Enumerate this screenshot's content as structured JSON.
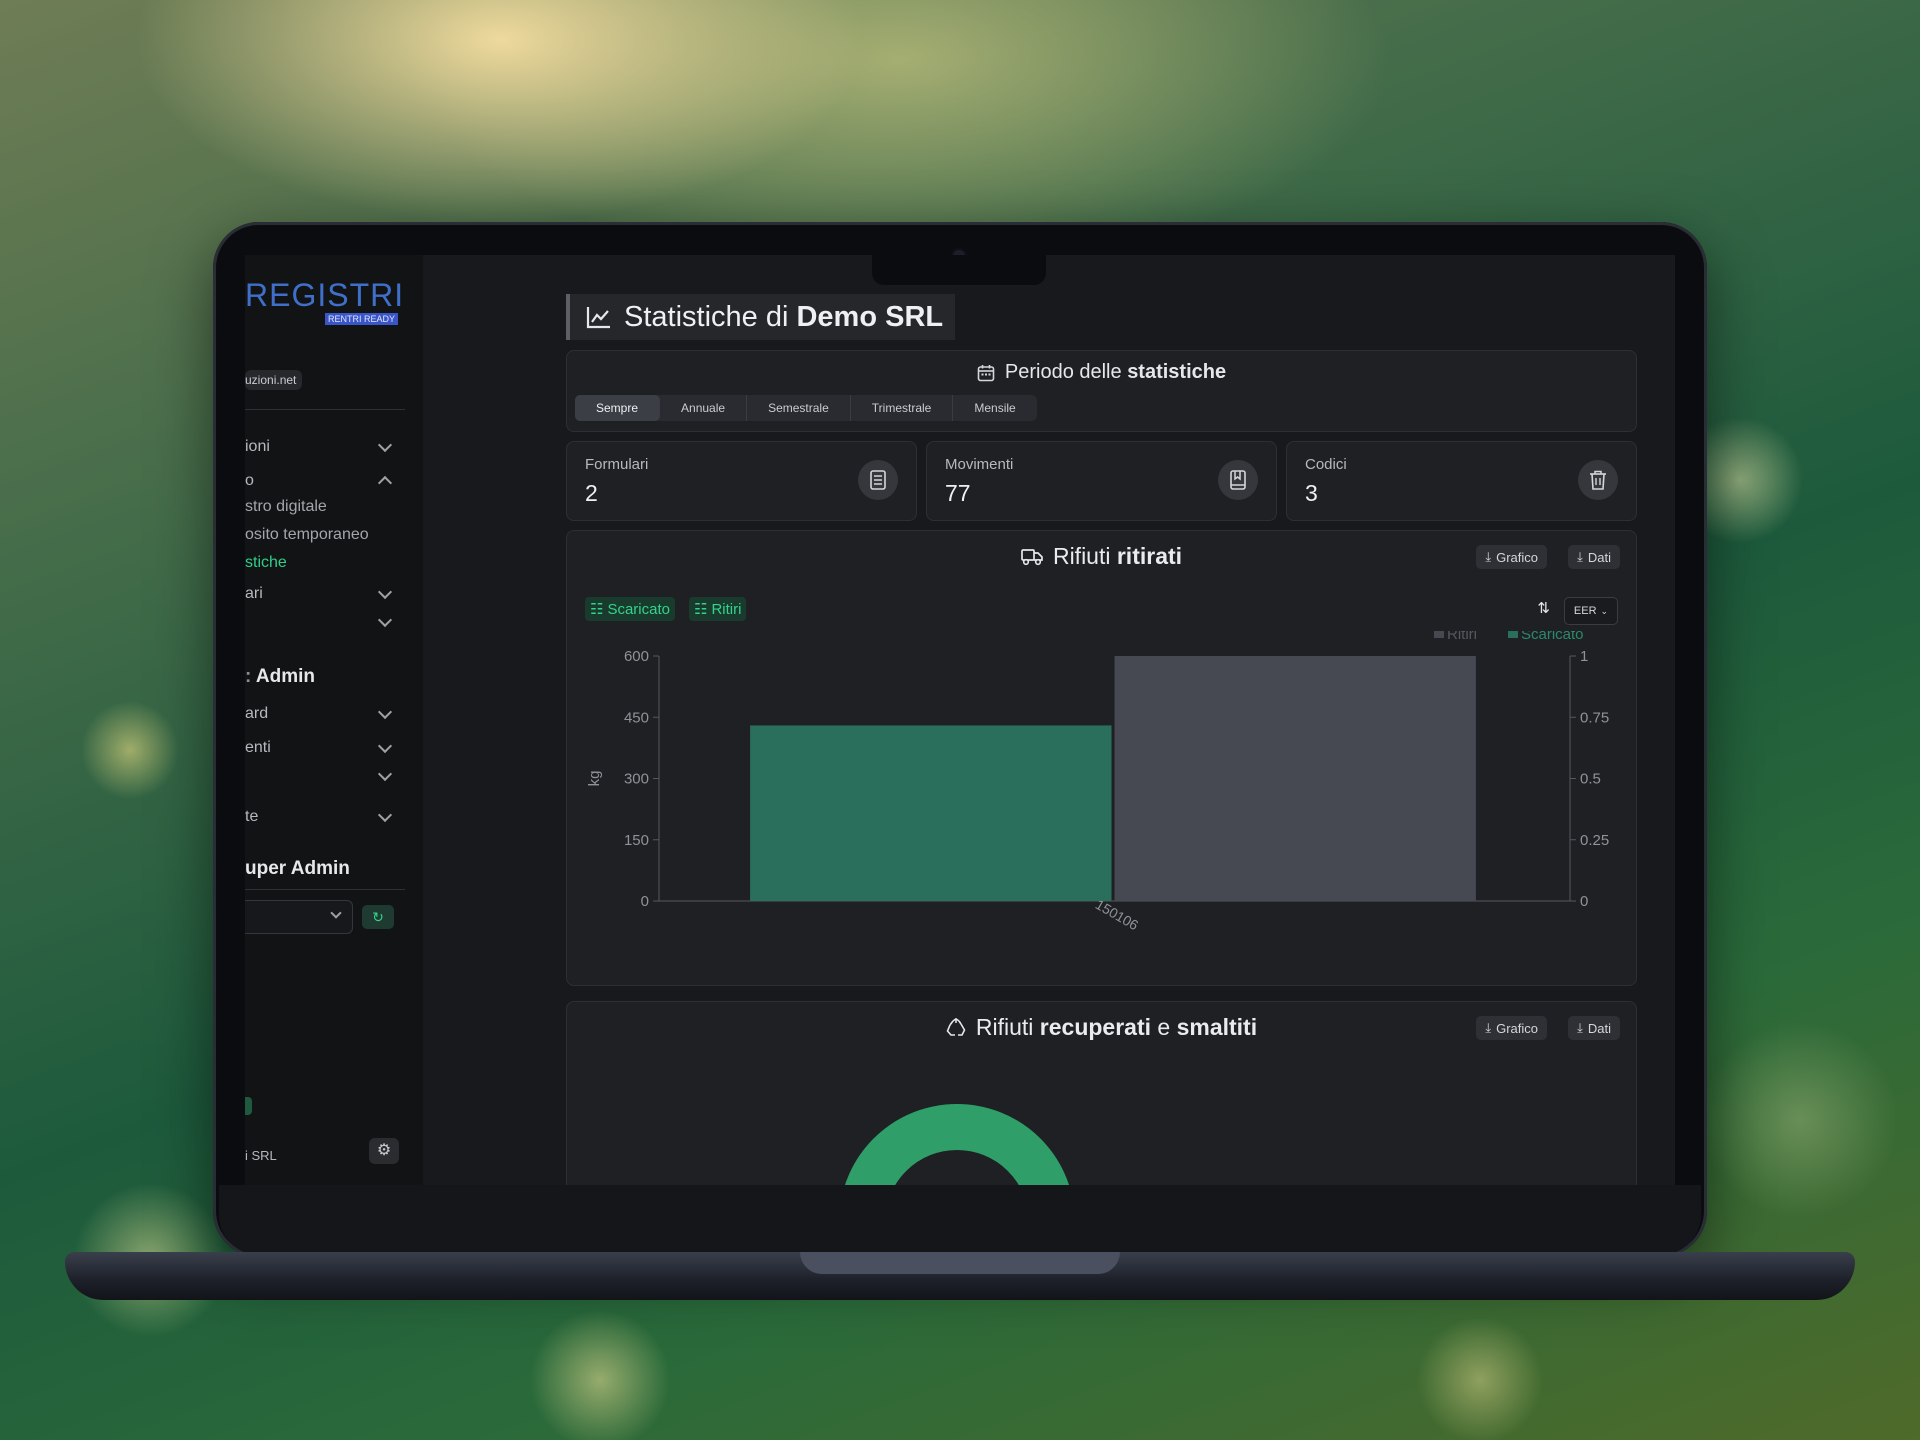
{
  "sidebar": {
    "logo_text": "REGISTRI",
    "logo_badge": "RENTRI READY",
    "org_chip": "uzioni.net",
    "items": [
      {
        "label": "ioni"
      },
      {
        "label": "o"
      },
      {
        "label": "ari"
      },
      {
        "label": ""
      },
      {
        "label": "ard"
      },
      {
        "label": "enti"
      },
      {
        "label": ""
      },
      {
        "label": "te"
      }
    ],
    "sub_items": [
      {
        "label": "stro digitale"
      },
      {
        "label": "osito temporaneo"
      },
      {
        "label": "stiche"
      }
    ],
    "section_admin": "Admin",
    "section_super_admin": "uper Admin",
    "footer_company": "i SRL"
  },
  "header": {
    "title_prefix": "Statistiche di",
    "title_company": "Demo SRL"
  },
  "period": {
    "title_prefix": "Periodo delle",
    "title_bold": "statistiche",
    "tabs": [
      {
        "label": "Sempre",
        "active": true
      },
      {
        "label": "Annuale"
      },
      {
        "label": "Semestrale"
      },
      {
        "label": "Trimestrale"
      },
      {
        "label": "Mensile"
      }
    ]
  },
  "stats": [
    {
      "label": "Formulari",
      "value": "2",
      "icon": "document-list-icon"
    },
    {
      "label": "Movimenti",
      "value": "77",
      "icon": "bookmark-book-icon"
    },
    {
      "label": "Codici",
      "value": "3",
      "icon": "trash-icon"
    }
  ],
  "ritirati": {
    "title_prefix": "Rifiuti",
    "title_bold": "ritirati",
    "btn_chart": "Grafico",
    "btn_data": "Dati",
    "chips": [
      "Scaricato",
      "Ritiri"
    ],
    "sort_select": "EER",
    "colors": {
      "scaricato": "#2a6e5c",
      "ritiri": "#464951"
    }
  },
  "chart_data": {
    "type": "bar",
    "categories": [
      "150106"
    ],
    "series": [
      {
        "name": "Scaricato",
        "values": [
          430
        ],
        "axis": "left",
        "color": "#2a6e5c"
      },
      {
        "name": "Ritiri",
        "values": [
          1
        ],
        "axis": "right",
        "color": "#464951"
      }
    ],
    "ylabel": "kg",
    "ylim": [
      0,
      600
    ],
    "y_ticks": [
      "0",
      "150",
      "300",
      "450",
      "600"
    ],
    "y2lim": [
      0,
      1
    ],
    "y2_ticks": [
      "0",
      "0.25",
      "0.5",
      "0.75",
      "1"
    ],
    "legend": [
      "Ritiri",
      "Scaricato"
    ],
    "legend_position": "top-right",
    "grid": false
  },
  "recuperati": {
    "title_prefix": "Rifiuti",
    "title_bold1": "recuperati",
    "title_mid": "e",
    "title_bold2": "smaltiti",
    "btn_chart": "Grafico",
    "btn_data": "Dati",
    "color": "#2f9e68"
  }
}
